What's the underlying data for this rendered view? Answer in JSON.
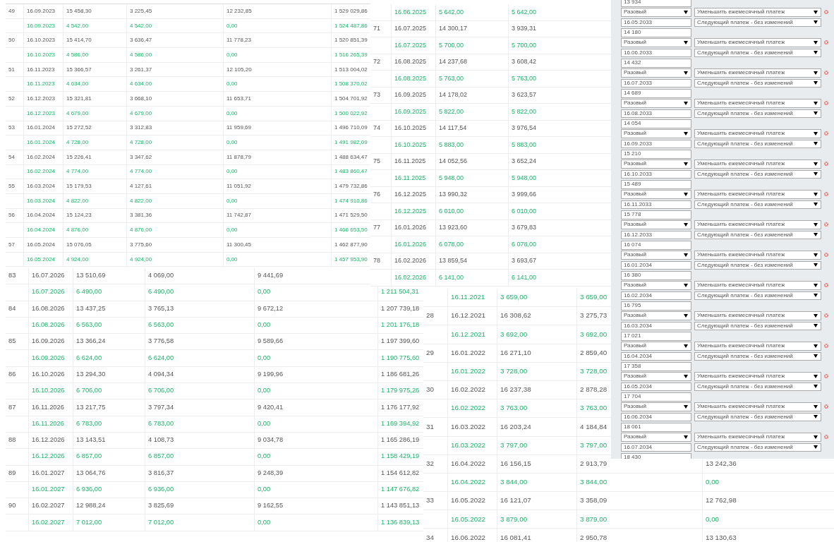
{
  "tables": [
    {
      "rows": [
        {
          "kind": "scheduled",
          "number": "49",
          "cells": [
            "16.09.2023",
            "15 458,30",
            "3 225,45",
            "12 232,85",
            "1 529 029,86"
          ]
        },
        {
          "kind": "payment",
          "cells": [
            "16.09.2023",
            "4 542,00",
            "4 542,00",
            "0,00",
            "1 524 487,86"
          ]
        },
        {
          "kind": "scheduled",
          "number": "50",
          "cells": [
            "16.10.2023",
            "15 414,70",
            "3 636,47",
            "11 778,23",
            "1 520 851,39"
          ]
        },
        {
          "kind": "payment",
          "cells": [
            "16.10.2023",
            "4 586,00",
            "4 586,00",
            "0,00",
            "1 516 265,39"
          ]
        },
        {
          "kind": "scheduled",
          "number": "51",
          "cells": [
            "16.11.2023",
            "15 366,57",
            "3 261,37",
            "12 105,20",
            "1 513 004,02"
          ]
        },
        {
          "kind": "payment",
          "cells": [
            "16.11.2023",
            "4 634,00",
            "4 634,00",
            "0,00",
            "1 508 370,02"
          ]
        },
        {
          "kind": "scheduled",
          "number": "52",
          "cells": [
            "16.12.2023",
            "15 321,81",
            "3 668,10",
            "11 653,71",
            "1 504 701,92"
          ]
        },
        {
          "kind": "payment",
          "cells": [
            "16.12.2023",
            "4 679,00",
            "4 679,00",
            "0,00",
            "1 500 022,92"
          ]
        },
        {
          "kind": "scheduled",
          "number": "53",
          "cells": [
            "16.01.2024",
            "15 272,52",
            "3 312,83",
            "11 959,69",
            "1 496 710,09"
          ]
        },
        {
          "kind": "payment",
          "cells": [
            "16.01.2024",
            "4 728,00",
            "4 728,00",
            "0,00",
            "1 491 982,09"
          ]
        },
        {
          "kind": "scheduled",
          "number": "54",
          "cells": [
            "16.02.2024",
            "15 226,41",
            "3 347,62",
            "11 878,79",
            "1 488 634,47"
          ]
        },
        {
          "kind": "payment",
          "cells": [
            "16.02.2024",
            "4 774,00",
            "4 774,00",
            "0,00",
            "1 483 860,47"
          ]
        },
        {
          "kind": "scheduled",
          "number": "55",
          "cells": [
            "16.03.2024",
            "15 179,53",
            "4 127,61",
            "11 051,92",
            "1 479 732,86"
          ]
        },
        {
          "kind": "payment",
          "cells": [
            "16.03.2024",
            "4 822,00",
            "4 822,00",
            "0,00",
            "1 474 910,86"
          ]
        },
        {
          "kind": "scheduled",
          "number": "56",
          "cells": [
            "16.04.2024",
            "15 124,23",
            "3 381,36",
            "11 742,87",
            "1 471 529,50"
          ]
        },
        {
          "kind": "payment",
          "cells": [
            "16.04.2024",
            "4 876,00",
            "4 876,00",
            "0,00",
            "1 466 653,50"
          ]
        },
        {
          "kind": "scheduled",
          "number": "57",
          "cells": [
            "16.05.2024",
            "15 076,05",
            "3 775,60",
            "11 300,45",
            "1 462 877,90"
          ]
        },
        {
          "kind": "payment",
          "cells": [
            "16.05.2024",
            "4 924,00",
            "4 924,00",
            "0,00",
            "1 457 953,90"
          ]
        }
      ]
    },
    {
      "rows": [
        {
          "kind": "payment",
          "cells": [
            "16.06.2025",
            "5 642,00",
            "5 642,00"
          ]
        },
        {
          "kind": "scheduled",
          "number": "71",
          "cells": [
            "16.07.2025",
            "14 300,17",
            "3 939,31"
          ]
        },
        {
          "kind": "payment",
          "cells": [
            "16.07.2025",
            "5 700,00",
            "5 700,00"
          ]
        },
        {
          "kind": "scheduled",
          "number": "72",
          "cells": [
            "16.08.2025",
            "14 237,68",
            "3 608,42"
          ]
        },
        {
          "kind": "payment",
          "cells": [
            "16.08.2025",
            "5 763,00",
            "5 763,00"
          ]
        },
        {
          "kind": "scheduled",
          "number": "73",
          "cells": [
            "16.09.2025",
            "14 178,02",
            "3 623,57"
          ]
        },
        {
          "kind": "payment",
          "cells": [
            "16.09.2025",
            "5 822,00",
            "5 822,00"
          ]
        },
        {
          "kind": "scheduled",
          "number": "74",
          "cells": [
            "16.10.2025",
            "14 117,54",
            "3 976,54"
          ]
        },
        {
          "kind": "payment",
          "cells": [
            "16.10.2025",
            "5 883,00",
            "5 883,00"
          ]
        },
        {
          "kind": "scheduled",
          "number": "75",
          "cells": [
            "16.11.2025",
            "14 052,56",
            "3 652,24"
          ]
        },
        {
          "kind": "payment",
          "cells": [
            "16.11.2025",
            "5 948,00",
            "5 948,00"
          ]
        },
        {
          "kind": "scheduled",
          "number": "76",
          "cells": [
            "16.12.2025",
            "13 990,32",
            "3 999,66"
          ]
        },
        {
          "kind": "payment",
          "cells": [
            "16.12.2025",
            "6 010,00",
            "6 010,00"
          ]
        },
        {
          "kind": "scheduled",
          "number": "77",
          "cells": [
            "16.01.2026",
            "13 923,60",
            "3 679,83"
          ]
        },
        {
          "kind": "payment",
          "cells": [
            "16.01.2026",
            "6 078,00",
            "6 078,00"
          ]
        },
        {
          "kind": "scheduled",
          "number": "78",
          "cells": [
            "16.02.2026",
            "13 859,54",
            "3 693,67"
          ]
        },
        {
          "kind": "payment",
          "cells": [
            "16.02.2026",
            "6 141,00",
            "6 141,00"
          ]
        }
      ]
    },
    {
      "rows": [
        {
          "kind": "scheduled",
          "number": "83",
          "cells": [
            "16.07.2026",
            "13 510,69",
            "4 069,00",
            "9 441,69"
          ]
        },
        {
          "kind": "payment",
          "cells": [
            "16.07.2026",
            "6 490,00",
            "6 490,00",
            "0,00",
            "1 211 504,31"
          ]
        },
        {
          "kind": "scheduled",
          "number": "84",
          "cells": [
            "16.08.2026",
            "13 437,25",
            "3 765,13",
            "9 672,12",
            "1 207 739,18"
          ]
        },
        {
          "kind": "payment",
          "cells": [
            "16.08.2026",
            "6 563,00",
            "6 563,00",
            "0,00",
            "1 201 176,18"
          ]
        },
        {
          "kind": "scheduled",
          "number": "85",
          "cells": [
            "16.09.2026",
            "13 366,24",
            "3 776,58",
            "9 589,66",
            "1 197 399,60"
          ]
        },
        {
          "kind": "payment",
          "cells": [
            "16.09.2026",
            "6 624,00",
            "6 624,00",
            "0,00",
            "1 190 775,60"
          ]
        },
        {
          "kind": "scheduled",
          "number": "86",
          "cells": [
            "16.10.2026",
            "13 294,30",
            "4 094,34",
            "9 199,96",
            "1 186 681,26"
          ]
        },
        {
          "kind": "payment",
          "cells": [
            "16.10.2026",
            "6 706,00",
            "6 706,00",
            "0,00",
            "1 179 975,26"
          ]
        },
        {
          "kind": "scheduled",
          "number": "87",
          "cells": [
            "16.11.2026",
            "13 217,75",
            "3 797,34",
            "9 420,41",
            "1 176 177,92"
          ]
        },
        {
          "kind": "payment",
          "cells": [
            "16.11.2026",
            "6 783,00",
            "6 783,00",
            "0,00",
            "1 169 394,92"
          ]
        },
        {
          "kind": "scheduled",
          "number": "88",
          "cells": [
            "16.12.2026",
            "13 143,51",
            "4 108,73",
            "9 034,78",
            "1 165 286,19"
          ]
        },
        {
          "kind": "payment",
          "cells": [
            "16.12.2026",
            "6 857,00",
            "6 857,00",
            "0,00",
            "1 158 429,19"
          ]
        },
        {
          "kind": "scheduled",
          "number": "89",
          "cells": [
            "16.01.2027",
            "13 064,76",
            "3 816,37",
            "9 248,39",
            "1 154 612,82"
          ]
        },
        {
          "kind": "payment",
          "cells": [
            "16.01.2027",
            "6 936,00",
            "6 936,00",
            "0,00",
            "1 147 676,82"
          ]
        },
        {
          "kind": "scheduled",
          "number": "90",
          "cells": [
            "16.02.2027",
            "12 988,24",
            "3 825,69",
            "9 162,55",
            "1 143 851,13"
          ]
        },
        {
          "kind": "payment",
          "cells": [
            "16.02.2027",
            "7 012,00",
            "7 012,00",
            "0,00",
            "1 136 839,13"
          ]
        }
      ]
    },
    {
      "rows": [
        {
          "kind": "payment",
          "cells": [
            "16.11.2021",
            "3 659,00",
            "3 659,00"
          ]
        },
        {
          "kind": "scheduled",
          "number": "28",
          "cells": [
            "16.12.2021",
            "16 308,62",
            "3 275,73"
          ]
        },
        {
          "kind": "payment",
          "cells": [
            "16.12.2021",
            "3 692,00",
            "3 692,00"
          ]
        },
        {
          "kind": "scheduled",
          "number": "29",
          "cells": [
            "16.01.2022",
            "16 271,10",
            "2 859,40"
          ]
        },
        {
          "kind": "payment",
          "cells": [
            "16.01.2022",
            "3 728,00",
            "3 728,00"
          ]
        },
        {
          "kind": "scheduled",
          "number": "30",
          "cells": [
            "16.02.2022",
            "16 237,38",
            "2 878,28"
          ]
        },
        {
          "kind": "payment",
          "cells": [
            "16.02.2022",
            "3 763,00",
            "3 763,00"
          ]
        },
        {
          "kind": "scheduled",
          "number": "31",
          "cells": [
            "16.03.2022",
            "16 203,24",
            "4 184,84"
          ]
        },
        {
          "kind": "payment",
          "cells": [
            "16.03.2022",
            "3 797,00",
            "3 797,00"
          ]
        },
        {
          "kind": "scheduled",
          "number": "32",
          "cells": [
            "16.04.2022",
            "16 156,15",
            "2 913,79",
            "13 242,36"
          ]
        },
        {
          "kind": "payment",
          "cells": [
            "16.04.2022",
            "3 844,00",
            "3 844,00",
            "0,00"
          ]
        },
        {
          "kind": "scheduled",
          "number": "33",
          "cells": [
            "16.05.2022",
            "16 121,07",
            "3 358,09",
            "12 762,98"
          ]
        },
        {
          "kind": "payment",
          "cells": [
            "16.05.2022",
            "3 879,00",
            "3 879,00",
            "0,00"
          ]
        },
        {
          "kind": "scheduled",
          "number": "34",
          "cells": [
            "16.06.2022",
            "16 081,41",
            "2 950,78",
            "13 130,63"
          ]
        }
      ]
    }
  ],
  "repayment_form": {
    "leading_amount": "13 934",
    "entries": [
      {
        "type": "Разовый",
        "mode": "Уменьшить ежемесячный платеж",
        "date": "16.05.2033",
        "next_payment": "Следующий платеж - без изменений",
        "amount": "14 180"
      },
      {
        "type": "Разовый",
        "mode": "Уменьшить ежемесячный платеж",
        "date": "16.06.2033",
        "next_payment": "Следующий платеж - без изменений",
        "amount": "14 432"
      },
      {
        "type": "Разовый",
        "mode": "Уменьшить ежемесячный платеж",
        "date": "16.07.2033",
        "next_payment": "Следующий платеж - без изменений",
        "amount": "14 689"
      },
      {
        "type": "Разовый",
        "mode": "Уменьшить ежемесячный платеж",
        "date": "16.08.2033",
        "next_payment": "Следующий платеж - без изменений",
        "amount": "14 054"
      },
      {
        "type": "Разовый",
        "mode": "Уменьшить ежемесячный платеж",
        "date": "16.09.2033",
        "next_payment": "Следующий платеж - без изменений",
        "amount": "15 210"
      },
      {
        "type": "Разовый",
        "mode": "Уменьшить ежемесячный платеж",
        "date": "16.10.2033",
        "next_payment": "Следующий платеж - без изменений",
        "amount": "15 489"
      },
      {
        "type": "Разовый",
        "mode": "Уменьшить ежемесячный платеж",
        "date": "16.11.2033",
        "next_payment": "Следующий платеж - без изменений",
        "amount": "15 778"
      },
      {
        "type": "Разовый",
        "mode": "Уменьшить ежемесячный платеж",
        "date": "16.12.2033",
        "next_payment": "Следующий платеж - без изменений",
        "amount": "16 074"
      },
      {
        "type": "Разовый",
        "mode": "Уменьшить ежемесячный платеж",
        "date": "16.01.2034",
        "next_payment": "Следующий платеж - без изменений",
        "amount": "16 380"
      },
      {
        "type": "Разовый",
        "mode": "Уменьшить ежемесячный платеж",
        "date": "16.02.2034",
        "next_payment": "Следующий платеж - без изменений",
        "amount": "16 795"
      },
      {
        "type": "Разовый",
        "mode": "Уменьшить ежемесячный платеж",
        "date": "16.03.2034",
        "next_payment": "Следующий платеж - без изменений",
        "amount": "17 021"
      },
      {
        "type": "Разовый",
        "mode": "Уменьшить ежемесячный платеж",
        "date": "16.04.2034",
        "next_payment": "Следующий платеж - без изменений",
        "amount": "17 358"
      },
      {
        "type": "Разовый",
        "mode": "Уменьшить ежемесячный платеж",
        "date": "16.05.2034",
        "next_payment": "Следующий платеж - без изменений",
        "amount": "17 704"
      },
      {
        "type": "Разовый",
        "mode": "Уменьшить ежемесячный платеж",
        "date": "16.06.2034",
        "next_payment": "Следующий платеж - без изменений",
        "amount": "18 061"
      },
      {
        "type": "Разовый",
        "mode": "Уменьшить ежемесячный платеж",
        "date": "16.07.2034",
        "next_payment": "Следующий платеж - без изменений",
        "amount": "18 430"
      }
    ]
  }
}
